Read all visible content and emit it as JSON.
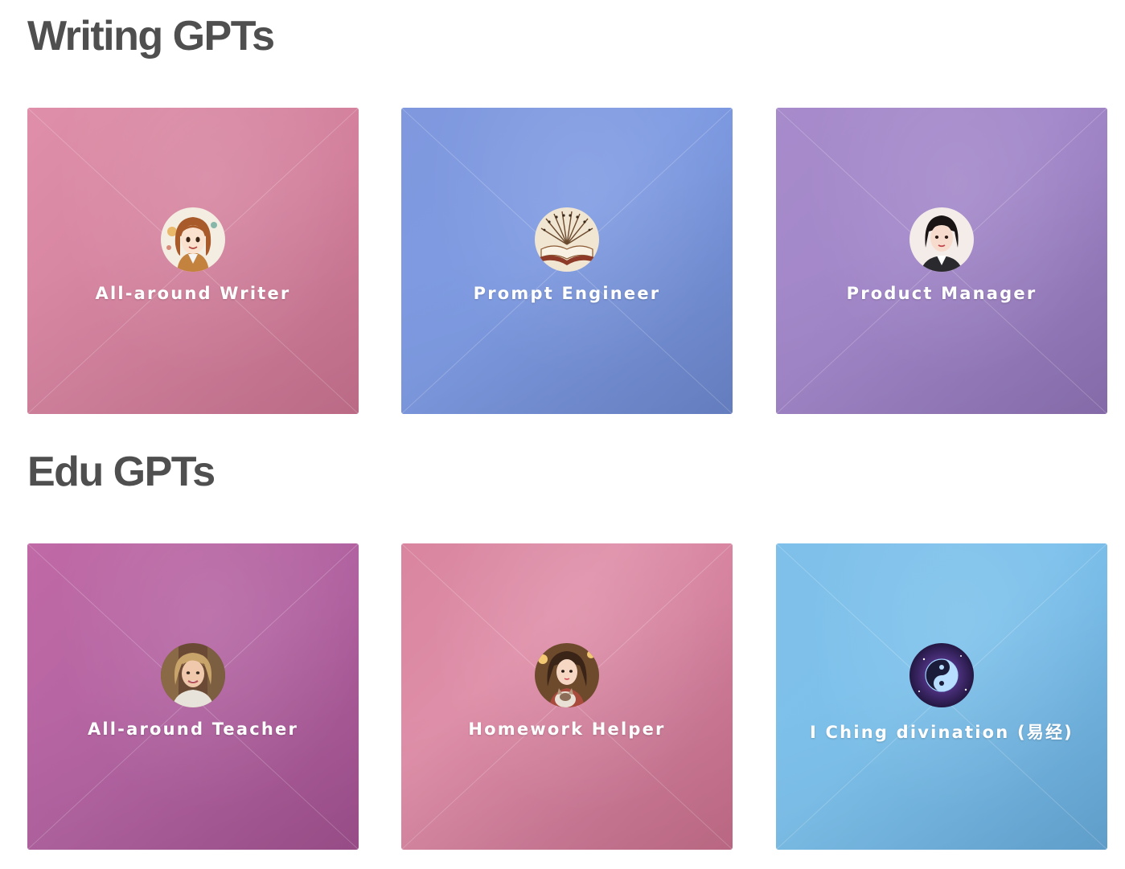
{
  "sections": [
    {
      "title": "Writing GPTs",
      "cards": [
        {
          "label": "All-around Writer",
          "avatar_icon": "writer-avatar-icon",
          "color": "#d4829e"
        },
        {
          "label": "Prompt Engineer",
          "avatar_icon": "open-book-avatar-icon",
          "color": "#7f9be2"
        },
        {
          "label": "Product Manager",
          "avatar_icon": "manager-avatar-icon",
          "color": "#a287c9"
        }
      ]
    },
    {
      "title": "Edu GPTs",
      "cards": [
        {
          "label": "All-around Teacher",
          "avatar_icon": "teacher-avatar-icon",
          "color": "#b263a1"
        },
        {
          "label": "Homework Helper",
          "avatar_icon": "helper-avatar-icon",
          "color": "#d9859f"
        },
        {
          "label": "I Ching divination (易经)",
          "avatar_icon": "yin-yang-avatar-icon",
          "color": "#7dc1eb"
        }
      ]
    }
  ]
}
